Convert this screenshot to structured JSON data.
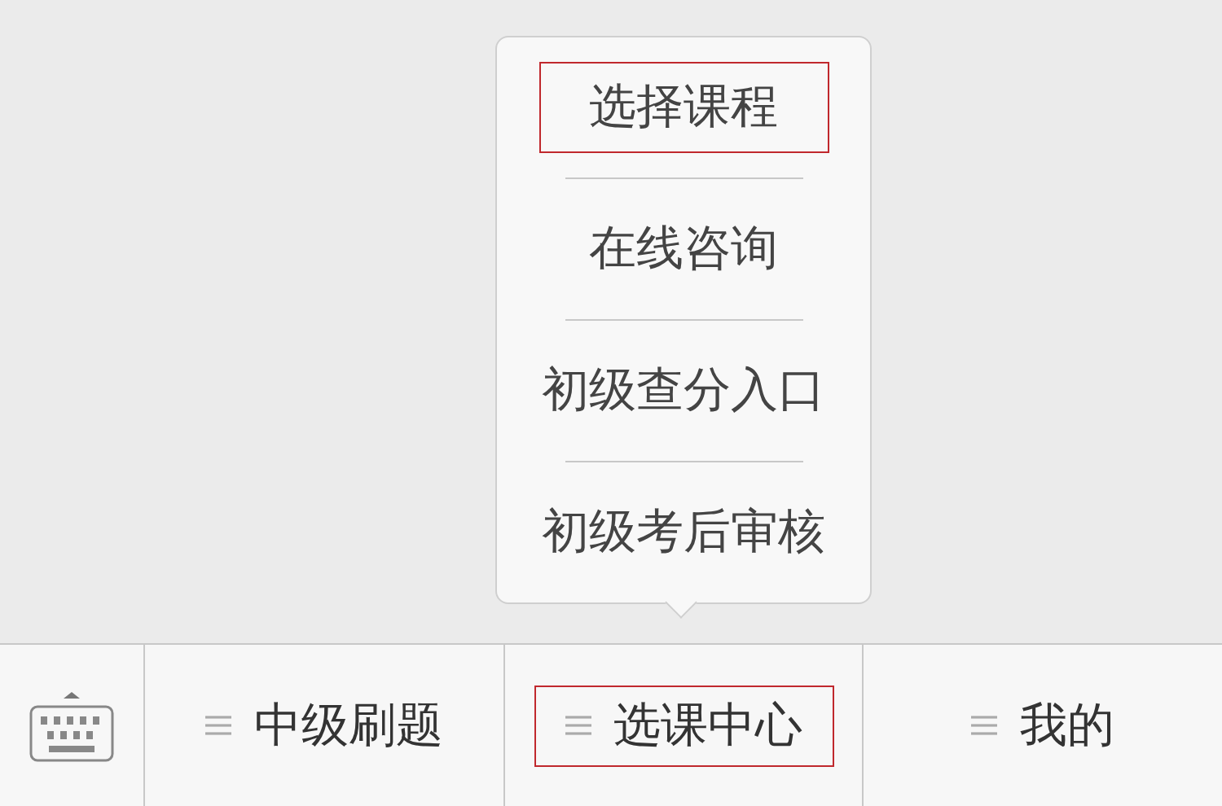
{
  "popup_menu": {
    "items": [
      {
        "label": "选择课程",
        "highlighted": true
      },
      {
        "label": "在线咨询",
        "highlighted": false
      },
      {
        "label": "初级查分入口",
        "highlighted": false
      },
      {
        "label": "初级考后审核",
        "highlighted": false
      }
    ]
  },
  "bottom_menu": {
    "items": [
      {
        "label": "中级刷题",
        "highlighted": false
      },
      {
        "label": "选课中心",
        "highlighted": true
      },
      {
        "label": "我的",
        "highlighted": false
      }
    ]
  }
}
